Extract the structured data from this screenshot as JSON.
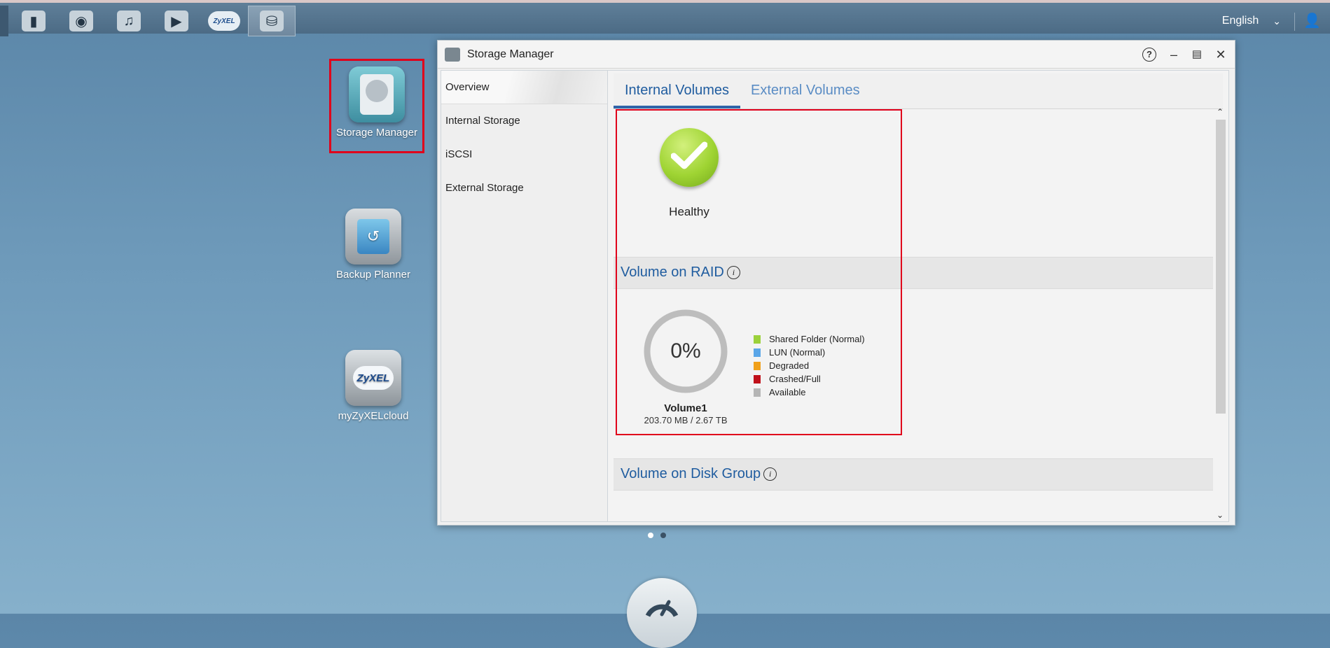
{
  "taskbar": {
    "apps": [
      {
        "name": "file-browser-icon",
        "glyph": "▮"
      },
      {
        "name": "photo-camera-icon",
        "glyph": "◉"
      },
      {
        "name": "music-player-icon",
        "glyph": "♫"
      },
      {
        "name": "video-player-icon",
        "glyph": "▶"
      },
      {
        "name": "zyxel-cloud-icon",
        "label": "ZyXEL"
      },
      {
        "name": "storage-manager-icon",
        "glyph": "⛁"
      }
    ],
    "language": "English",
    "user_icon": "user-icon"
  },
  "desktop": {
    "icons": [
      {
        "label": "Storage Manager"
      },
      {
        "label": "Backup Planner"
      },
      {
        "label": "myZyXELcloud"
      }
    ],
    "cloud_icon_text": "ZyXEL"
  },
  "window": {
    "title": "Storage Manager",
    "nav": [
      "Overview",
      "Internal Storage",
      "iSCSI",
      "External Storage"
    ],
    "tabs": [
      "Internal Volumes",
      "External Volumes"
    ],
    "status": "Healthy",
    "raid_section": "Volume on RAID",
    "disk_group_section": "Volume on Disk Group",
    "info_glyph": "i",
    "volume": {
      "usage_label": "0%",
      "usage_fraction": 0,
      "name": "Volume1",
      "size": "203.70 MB / 2.67 TB"
    },
    "legend": [
      {
        "label": "Shared Folder (Normal)",
        "color": "#9bd13b"
      },
      {
        "label": "LUN (Normal)",
        "color": "#5aa6e8"
      },
      {
        "label": "Degraded",
        "color": "#f0a01a"
      },
      {
        "label": "Crashed/Full",
        "color": "#c0101a"
      },
      {
        "label": "Available",
        "color": "#b5b5b5"
      }
    ]
  },
  "pager": {
    "pages": 2,
    "current": 1
  }
}
